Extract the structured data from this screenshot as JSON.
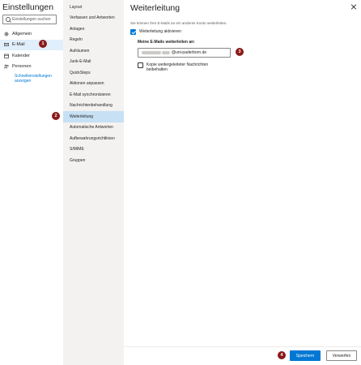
{
  "app_title": "Einstellungen",
  "search": {
    "placeholder": "Einstellungen suchen"
  },
  "nav": [
    {
      "label": "Allgemein",
      "icon": "gear-icon"
    },
    {
      "label": "E-Mail",
      "icon": "mail-icon",
      "active": true
    },
    {
      "label": "Kalender",
      "icon": "calendar-icon"
    },
    {
      "label": "Personen",
      "icon": "people-icon"
    }
  ],
  "quick_settings_link": "Schnelleinstellungen anzeigen",
  "subnav": [
    "Layout",
    "Verfassen und Antworten",
    "Anlagen",
    "Regeln",
    "Aufräumen",
    "Junk-E-Mail",
    "QuickSteps",
    "Aktionen anpassen",
    "E-Mail synchronisieren",
    "Nachrichtenbehandlung",
    "Weiterleitung",
    "Automatische Antworten",
    "Aufbewahrungsrichtlinien",
    "S/MIME",
    "Gruppen"
  ],
  "subnav_active": "Weiterleitung",
  "panel": {
    "title": "Weiterleitung",
    "description": "Sie können Ihre E-Mails an ein anderes Konto weiterleiten.",
    "enable_label": "Weiterleitung aktivieren",
    "enable_checked": true,
    "address_label": "Meine E-Mails weiterleiten an:",
    "address_value_visible": "@uni-paderborn.de",
    "keep_copy_label": "Kopie weitergeleiteter Nachrichten beibehalten",
    "keep_copy_checked": false,
    "save_label": "Speichern",
    "discard_label": "Verwerfen"
  },
  "badges": [
    "1",
    "2",
    "3",
    "4"
  ],
  "colors": {
    "accent": "#0078d4",
    "badge": "#8b1a1a",
    "subnav_bg": "#f3f2f1",
    "active_bg": "#c7e0f4"
  }
}
